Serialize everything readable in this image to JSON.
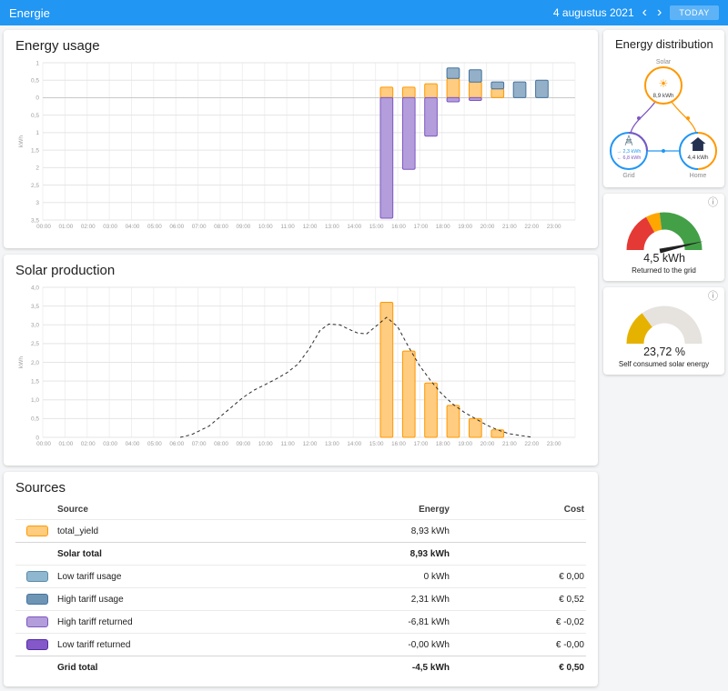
{
  "header": {
    "title": "Energie",
    "date": "4 augustus 2021",
    "today_label": "TODAY"
  },
  "icons": {
    "prev": "‹",
    "next": "›",
    "info": "ⓘ",
    "sun": "☀"
  },
  "colors": {
    "header_blue": "#2196f3",
    "solar_orange": "#ff9800",
    "grid_blue": "#2196f3",
    "grid_consumption": "#44739e",
    "return_purple": "#7e57c2",
    "gauge_red": "#e53935",
    "gauge_yellow": "#ffa600",
    "gauge_green": "#43a047",
    "gauge_gold": "#e6b200",
    "gauge_rest": "#e6e3df"
  },
  "hours": [
    "00:00",
    "01:00",
    "02:00",
    "03:00",
    "04:00",
    "05:00",
    "06:00",
    "07:00",
    "08:00",
    "09:00",
    "10:00",
    "11:00",
    "12:00",
    "13:00",
    "14:00",
    "15:00",
    "16:00",
    "17:00",
    "18:00",
    "19:00",
    "20:00",
    "21:00",
    "22:00",
    "23:00"
  ],
  "energy_usage": {
    "title": "Energy usage",
    "unit": "kWh",
    "ymin": -3.5,
    "ymax": 1,
    "yticks": [
      {
        "v": 1,
        "label": "1"
      },
      {
        "v": 0.5,
        "label": "0,5"
      },
      {
        "v": 0,
        "label": "0"
      },
      {
        "v": -0.5,
        "label": "0,5"
      },
      {
        "v": -1,
        "label": "1"
      },
      {
        "v": -1.5,
        "label": "1,5"
      },
      {
        "v": -2,
        "label": "2"
      },
      {
        "v": -2.5,
        "label": "2,5"
      },
      {
        "v": -3,
        "label": "3"
      },
      {
        "v": -3.5,
        "label": "3,5"
      }
    ],
    "series": [
      {
        "name": "solar-consumption",
        "color": "#ffcc80",
        "border": "#ff9800",
        "values": [
          0,
          0,
          0,
          0,
          0,
          0,
          0,
          0,
          0,
          0,
          0,
          0,
          0,
          0,
          0,
          0.3,
          0.3,
          0.4,
          0.55,
          0.45,
          0.25,
          0,
          0,
          0
        ]
      },
      {
        "name": "grid-consumption",
        "color": "#94b0c8",
        "border": "#44739e",
        "values": [
          0,
          0,
          0,
          0,
          0,
          0,
          0,
          0,
          0,
          0,
          0,
          0,
          0,
          0,
          0,
          0,
          0,
          0,
          0.3,
          0.35,
          0.2,
          0.45,
          0.5,
          0
        ]
      },
      {
        "name": "grid-return",
        "color": "#b39ddb",
        "border": "#7e57c2",
        "values": [
          0,
          0,
          0,
          0,
          0,
          0,
          0,
          0,
          0,
          0,
          0,
          0,
          0,
          0,
          0,
          -3.45,
          -2.05,
          -1.1,
          -0.12,
          -0.08,
          0,
          0,
          0,
          0
        ]
      }
    ]
  },
  "solar_production": {
    "title": "Solar production",
    "unit": "kWh",
    "ymin": 0,
    "ymax": 4,
    "yticks": [
      {
        "v": 4,
        "label": "4,0"
      },
      {
        "v": 3.5,
        "label": "3,5"
      },
      {
        "v": 3,
        "label": "3,0"
      },
      {
        "v": 2.5,
        "label": "2,5"
      },
      {
        "v": 2,
        "label": "2,0"
      },
      {
        "v": 1.5,
        "label": "1,5"
      },
      {
        "v": 1,
        "label": "1,0"
      },
      {
        "v": 0.5,
        "label": "0,5"
      },
      {
        "v": 0,
        "label": "0"
      }
    ],
    "bars": {
      "name": "solar-production",
      "color": "#ffcc80",
      "border": "#ff9800",
      "values": [
        0,
        0,
        0,
        0,
        0,
        0,
        0,
        0,
        0,
        0,
        0,
        0,
        0,
        0,
        0,
        3.6,
        2.3,
        1.45,
        0.85,
        0.5,
        0.2,
        0,
        0,
        0
      ]
    },
    "forecast": {
      "name": "solar-forecast",
      "color": "#2b2b2b",
      "points": [
        [
          5.7,
          0
        ],
        [
          6.2,
          0.07
        ],
        [
          7,
          0.3
        ],
        [
          7.5,
          0.55
        ],
        [
          8,
          0.8
        ],
        [
          8.5,
          1.05
        ],
        [
          9,
          1.25
        ],
        [
          9.5,
          1.4
        ],
        [
          10,
          1.55
        ],
        [
          10.5,
          1.72
        ],
        [
          11,
          1.95
        ],
        [
          11.5,
          2.35
        ],
        [
          12,
          2.85
        ],
        [
          12.4,
          3.02
        ],
        [
          12.9,
          3.0
        ],
        [
          13.3,
          2.88
        ],
        [
          13.7,
          2.78
        ],
        [
          14.1,
          2.76
        ],
        [
          14.5,
          2.95
        ],
        [
          15,
          3.2
        ],
        [
          15.5,
          2.95
        ],
        [
          16,
          2.4
        ],
        [
          16.5,
          1.9
        ],
        [
          17,
          1.5
        ],
        [
          17.5,
          1.15
        ],
        [
          18,
          0.88
        ],
        [
          18.5,
          0.67
        ],
        [
          19,
          0.5
        ],
        [
          19.5,
          0.33
        ],
        [
          20,
          0.2
        ],
        [
          20.5,
          0.1
        ],
        [
          21,
          0.05
        ],
        [
          21.6,
          0
        ]
      ]
    }
  },
  "sources": {
    "title": "Sources",
    "columns": [
      "Source",
      "Energy",
      "Cost"
    ],
    "rows": [
      {
        "label": "total_yield",
        "swatch": "#ffcc80",
        "swatch_border": "#ff9800",
        "energy": "8,93 kWh",
        "cost": ""
      },
      {
        "label": "Solar total",
        "total": true,
        "energy": "8,93 kWh",
        "cost": ""
      },
      {
        "label": "Low tariff usage",
        "swatch": "#8fb7cf",
        "swatch_border": "#5a8bac",
        "energy": "0 kWh",
        "cost": "€ 0,00"
      },
      {
        "label": "High tariff usage",
        "swatch": "#6f95b5",
        "swatch_border": "#44739e",
        "energy": "2,31 kWh",
        "cost": "€ 0,52"
      },
      {
        "label": "High tariff returned",
        "swatch": "#b39ddb",
        "swatch_border": "#7e57c2",
        "energy": "-6,81 kWh",
        "cost": "€ -0,02"
      },
      {
        "label": "Low tariff returned",
        "swatch": "#8458c8",
        "swatch_border": "#512da8",
        "energy": "-0,00 kWh",
        "cost": "€ -0,00"
      },
      {
        "label": "Grid total",
        "total": true,
        "energy": "-4,5 kWh",
        "cost": "€ 0,50"
      }
    ]
  },
  "distribution": {
    "title": "Energy distribution",
    "nodes": {
      "solar": {
        "label": "Solar",
        "value": "8,9 kWh"
      },
      "grid": {
        "label": "Grid",
        "consumed": "→ 2,3 kWh",
        "returned": "← 6,8 kWh"
      },
      "home": {
        "label": "Home",
        "value": "4,4 kWh"
      }
    }
  },
  "gauge_returned": {
    "value": "4,5 kWh",
    "label": "Returned to the grid",
    "needle": 0.93,
    "segments": [
      {
        "from": 0,
        "to": 0.34,
        "color": "#e53935"
      },
      {
        "from": 0.34,
        "to": 0.46,
        "color": "#ffa600"
      },
      {
        "from": 0.46,
        "to": 1,
        "color": "#43a047"
      }
    ]
  },
  "gauge_self": {
    "value": "23,72 %",
    "label": "Self consumed solar energy",
    "segments": [
      {
        "from": 0,
        "to": 0.3,
        "color": "#e6b200"
      },
      {
        "from": 0.3,
        "to": 1,
        "color": "#e6e3df"
      }
    ]
  }
}
